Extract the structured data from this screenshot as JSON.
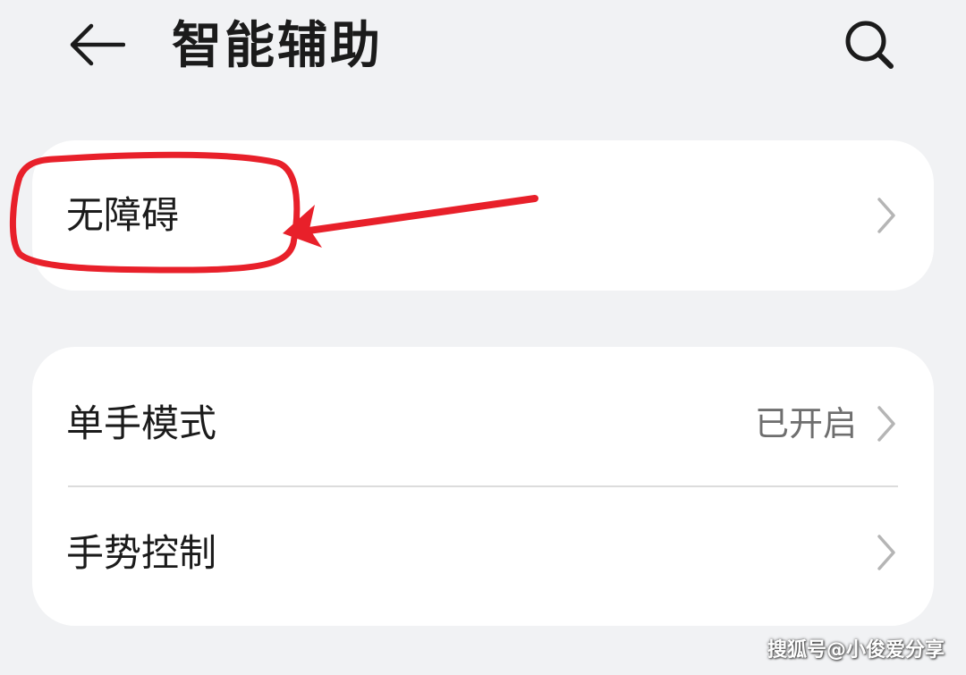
{
  "header": {
    "title": "智能辅助",
    "back_icon": "arrow-left-icon",
    "search_icon": "search-icon"
  },
  "group1": {
    "items": [
      {
        "label": "无障碍",
        "value": "",
        "icon": "chevron-right-icon"
      }
    ]
  },
  "group2": {
    "items": [
      {
        "label": "单手模式",
        "value": "已开启",
        "icon": "chevron-right-icon"
      },
      {
        "label": "手势控制",
        "value": "",
        "icon": "chevron-right-icon"
      }
    ]
  },
  "annotation": {
    "color": "#e8202a",
    "description_shape": "red ellipse with arrow"
  },
  "watermark": "搜狐号@小俊爱分享",
  "colors": {
    "background": "#f1f2f4",
    "card": "#ffffff",
    "text": "#1b1b1b",
    "secondary_text": "#6e6e6e",
    "chevron": "#b5b5b5"
  }
}
